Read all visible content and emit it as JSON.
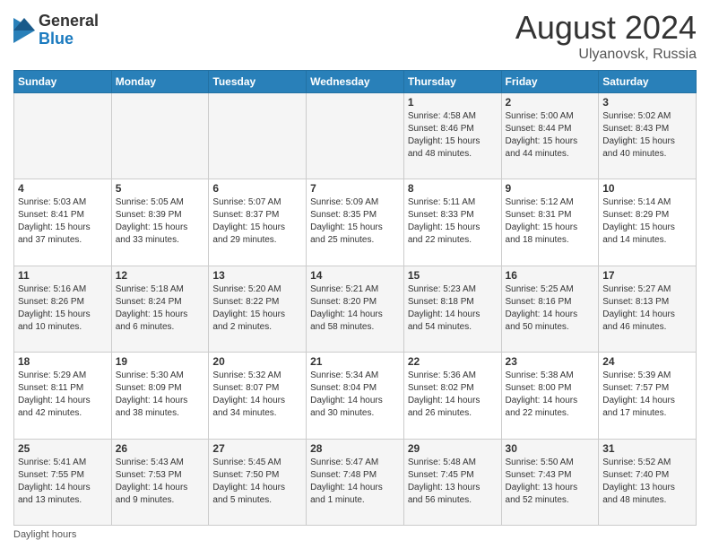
{
  "logo": {
    "general": "General",
    "blue": "Blue"
  },
  "header": {
    "month_year": "August 2024",
    "location": "Ulyanovsk, Russia"
  },
  "days_of_week": [
    "Sunday",
    "Monday",
    "Tuesday",
    "Wednesday",
    "Thursday",
    "Friday",
    "Saturday"
  ],
  "weeks": [
    [
      {
        "day": "",
        "info": ""
      },
      {
        "day": "",
        "info": ""
      },
      {
        "day": "",
        "info": ""
      },
      {
        "day": "",
        "info": ""
      },
      {
        "day": "1",
        "info": "Sunrise: 4:58 AM\nSunset: 8:46 PM\nDaylight: 15 hours\nand 48 minutes."
      },
      {
        "day": "2",
        "info": "Sunrise: 5:00 AM\nSunset: 8:44 PM\nDaylight: 15 hours\nand 44 minutes."
      },
      {
        "day": "3",
        "info": "Sunrise: 5:02 AM\nSunset: 8:43 PM\nDaylight: 15 hours\nand 40 minutes."
      }
    ],
    [
      {
        "day": "4",
        "info": "Sunrise: 5:03 AM\nSunset: 8:41 PM\nDaylight: 15 hours\nand 37 minutes."
      },
      {
        "day": "5",
        "info": "Sunrise: 5:05 AM\nSunset: 8:39 PM\nDaylight: 15 hours\nand 33 minutes."
      },
      {
        "day": "6",
        "info": "Sunrise: 5:07 AM\nSunset: 8:37 PM\nDaylight: 15 hours\nand 29 minutes."
      },
      {
        "day": "7",
        "info": "Sunrise: 5:09 AM\nSunset: 8:35 PM\nDaylight: 15 hours\nand 25 minutes."
      },
      {
        "day": "8",
        "info": "Sunrise: 5:11 AM\nSunset: 8:33 PM\nDaylight: 15 hours\nand 22 minutes."
      },
      {
        "day": "9",
        "info": "Sunrise: 5:12 AM\nSunset: 8:31 PM\nDaylight: 15 hours\nand 18 minutes."
      },
      {
        "day": "10",
        "info": "Sunrise: 5:14 AM\nSunset: 8:29 PM\nDaylight: 15 hours\nand 14 minutes."
      }
    ],
    [
      {
        "day": "11",
        "info": "Sunrise: 5:16 AM\nSunset: 8:26 PM\nDaylight: 15 hours\nand 10 minutes."
      },
      {
        "day": "12",
        "info": "Sunrise: 5:18 AM\nSunset: 8:24 PM\nDaylight: 15 hours\nand 6 minutes."
      },
      {
        "day": "13",
        "info": "Sunrise: 5:20 AM\nSunset: 8:22 PM\nDaylight: 15 hours\nand 2 minutes."
      },
      {
        "day": "14",
        "info": "Sunrise: 5:21 AM\nSunset: 8:20 PM\nDaylight: 14 hours\nand 58 minutes."
      },
      {
        "day": "15",
        "info": "Sunrise: 5:23 AM\nSunset: 8:18 PM\nDaylight: 14 hours\nand 54 minutes."
      },
      {
        "day": "16",
        "info": "Sunrise: 5:25 AM\nSunset: 8:16 PM\nDaylight: 14 hours\nand 50 minutes."
      },
      {
        "day": "17",
        "info": "Sunrise: 5:27 AM\nSunset: 8:13 PM\nDaylight: 14 hours\nand 46 minutes."
      }
    ],
    [
      {
        "day": "18",
        "info": "Sunrise: 5:29 AM\nSunset: 8:11 PM\nDaylight: 14 hours\nand 42 minutes."
      },
      {
        "day": "19",
        "info": "Sunrise: 5:30 AM\nSunset: 8:09 PM\nDaylight: 14 hours\nand 38 minutes."
      },
      {
        "day": "20",
        "info": "Sunrise: 5:32 AM\nSunset: 8:07 PM\nDaylight: 14 hours\nand 34 minutes."
      },
      {
        "day": "21",
        "info": "Sunrise: 5:34 AM\nSunset: 8:04 PM\nDaylight: 14 hours\nand 30 minutes."
      },
      {
        "day": "22",
        "info": "Sunrise: 5:36 AM\nSunset: 8:02 PM\nDaylight: 14 hours\nand 26 minutes."
      },
      {
        "day": "23",
        "info": "Sunrise: 5:38 AM\nSunset: 8:00 PM\nDaylight: 14 hours\nand 22 minutes."
      },
      {
        "day": "24",
        "info": "Sunrise: 5:39 AM\nSunset: 7:57 PM\nDaylight: 14 hours\nand 17 minutes."
      }
    ],
    [
      {
        "day": "25",
        "info": "Sunrise: 5:41 AM\nSunset: 7:55 PM\nDaylight: 14 hours\nand 13 minutes."
      },
      {
        "day": "26",
        "info": "Sunrise: 5:43 AM\nSunset: 7:53 PM\nDaylight: 14 hours\nand 9 minutes."
      },
      {
        "day": "27",
        "info": "Sunrise: 5:45 AM\nSunset: 7:50 PM\nDaylight: 14 hours\nand 5 minutes."
      },
      {
        "day": "28",
        "info": "Sunrise: 5:47 AM\nSunset: 7:48 PM\nDaylight: 14 hours\nand 1 minute."
      },
      {
        "day": "29",
        "info": "Sunrise: 5:48 AM\nSunset: 7:45 PM\nDaylight: 13 hours\nand 56 minutes."
      },
      {
        "day": "30",
        "info": "Sunrise: 5:50 AM\nSunset: 7:43 PM\nDaylight: 13 hours\nand 52 minutes."
      },
      {
        "day": "31",
        "info": "Sunrise: 5:52 AM\nSunset: 7:40 PM\nDaylight: 13 hours\nand 48 minutes."
      }
    ]
  ],
  "footer": {
    "daylight_label": "Daylight hours"
  }
}
